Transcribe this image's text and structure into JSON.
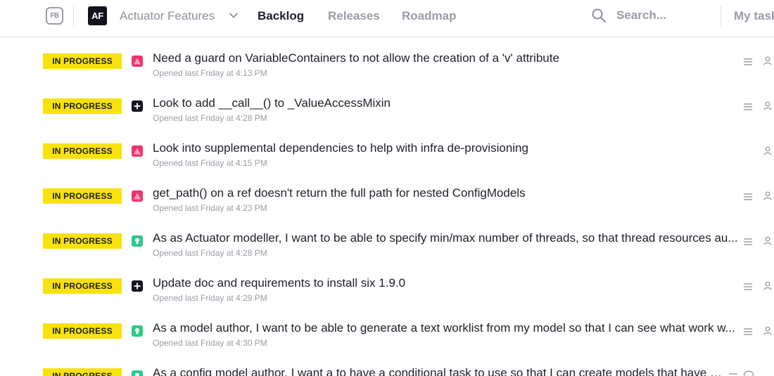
{
  "app": {
    "logo_text": "FB",
    "project_badge": "AF",
    "project_name": "Actuator Features"
  },
  "nav": {
    "tabs": [
      {
        "label": "Backlog",
        "active": true
      },
      {
        "label": "Releases",
        "active": false
      },
      {
        "label": "Roadmap",
        "active": false
      }
    ],
    "search_placeholder": "Search...",
    "my_tasks_label": "My tasks"
  },
  "colors": {
    "status_in_progress": "#f8e20e",
    "bug": "#f0346b",
    "task": "#13121f",
    "story": "#2fc98a",
    "muted_text": "#9a9ca6"
  },
  "issues": [
    {
      "status": "IN PROGRESS",
      "type": "bug",
      "icon": "bug-triangle-icon",
      "title": "Need a guard on VariableContainers to not allow the creation of a 'v' attribute",
      "opened": "Opened last Friday at 4:13 PM",
      "has_description": true
    },
    {
      "status": "IN PROGRESS",
      "type": "task",
      "icon": "task-plus-icon",
      "title": "Look to add __call__() to _ValueAccessMixin",
      "opened": "Opened last Friday at 4:28 PM",
      "has_description": true
    },
    {
      "status": "IN PROGRESS",
      "type": "bug",
      "icon": "bug-triangle-icon",
      "title": "Look into supplemental dependencies to help with infra de-provisioning",
      "opened": "Opened last Friday at 4:15 PM",
      "has_description": false
    },
    {
      "status": "IN PROGRESS",
      "type": "bug",
      "icon": "bug-triangle-icon",
      "title": "get_path() on a ref doesn't return the full path for nested ConfigModels",
      "opened": "Opened last Friday at 4:23 PM",
      "has_description": true
    },
    {
      "status": "IN PROGRESS",
      "type": "story",
      "icon": "story-bulb-icon",
      "title": "As as Actuator modeller, I want to be able to specify min/max number of threads, so that thread resources au...",
      "opened": "Opened last Friday at 4:28 PM",
      "has_description": true
    },
    {
      "status": "IN PROGRESS",
      "type": "task",
      "icon": "task-plus-icon",
      "title": "Update doc and requirements to install six 1.9.0",
      "opened": "Opened last Friday at 4:29 PM",
      "has_description": true
    },
    {
      "status": "IN PROGRESS",
      "type": "story",
      "icon": "story-bulb-icon",
      "title": "As a model author, I want to be able to generate a text worklist from my model so that I can see what work w...",
      "opened": "Opened last Friday at 4:30 PM",
      "has_description": true
    },
    {
      "status": "IN PROGRESS",
      "type": "story",
      "icon": "story-bulb-icon",
      "title": "As a config model author, I want a to have a conditional task to use so that I can create models that have b...",
      "opened": "",
      "has_description": true,
      "has_comments": true
    }
  ]
}
